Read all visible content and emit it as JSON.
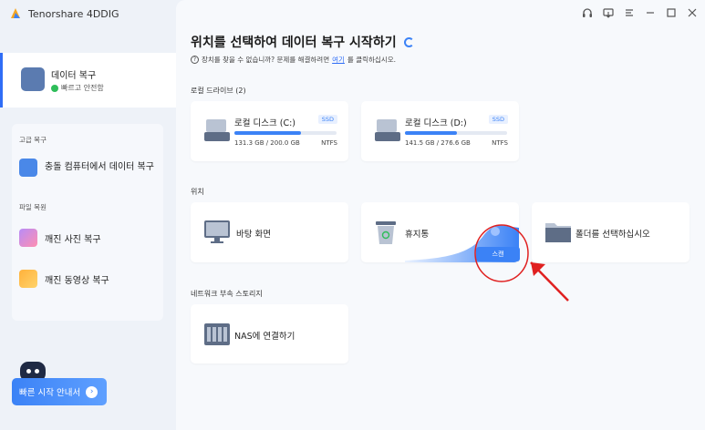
{
  "app": {
    "title": "Tenorshare 4DDIG"
  },
  "sidebar": {
    "primary": {
      "title": "데이터 복구",
      "subtitle": "빠르고 안전함"
    },
    "advanced_label": "고급 복구",
    "crashed_item": "충돌 컴퓨터에서 데이터 복구",
    "file_repair_label": "파일 복원",
    "photo_item": "깨진 사진 복구",
    "video_item": "깨진 동영상 복구",
    "quick_start": "빠른 시작 안내서"
  },
  "main": {
    "title": "위치를 선택하여 데이터 복구 시작하기",
    "help_text": "장치를 찾을 수 없습니까? 문제를 해결하려면 ",
    "help_link": "여기",
    "help_text_end": "를 클릭하십시오.",
    "local_drives_label": "로컬 드라이브 (2)",
    "drives": [
      {
        "name": "로컬 디스크 (C:)",
        "badge": "SSD",
        "size": "131.3 GB / 200.0 GB",
        "fs": "NTFS",
        "used_fraction": 0.656
      },
      {
        "name": "로컬 디스크 (D:)",
        "badge": "SSD",
        "size": "141.5 GB / 276.6 GB",
        "fs": "NTFS",
        "used_fraction": 0.512
      }
    ],
    "location_label": "위치",
    "locations": {
      "desktop": "바탕 화면",
      "recycle": "휴지통",
      "folder": "폴더를 선택하십시오"
    },
    "scan_label": "스캔",
    "network_label": "네트워크 부속 스토리지",
    "nas_label": "NAS에 연결하기"
  },
  "window_controls": [
    "headset-icon",
    "monitor-icon",
    "menu-icon",
    "minimize-icon",
    "maximize-icon",
    "close-icon"
  ],
  "colors": {
    "accent": "#3b82f6",
    "annotation": "#e02020"
  }
}
